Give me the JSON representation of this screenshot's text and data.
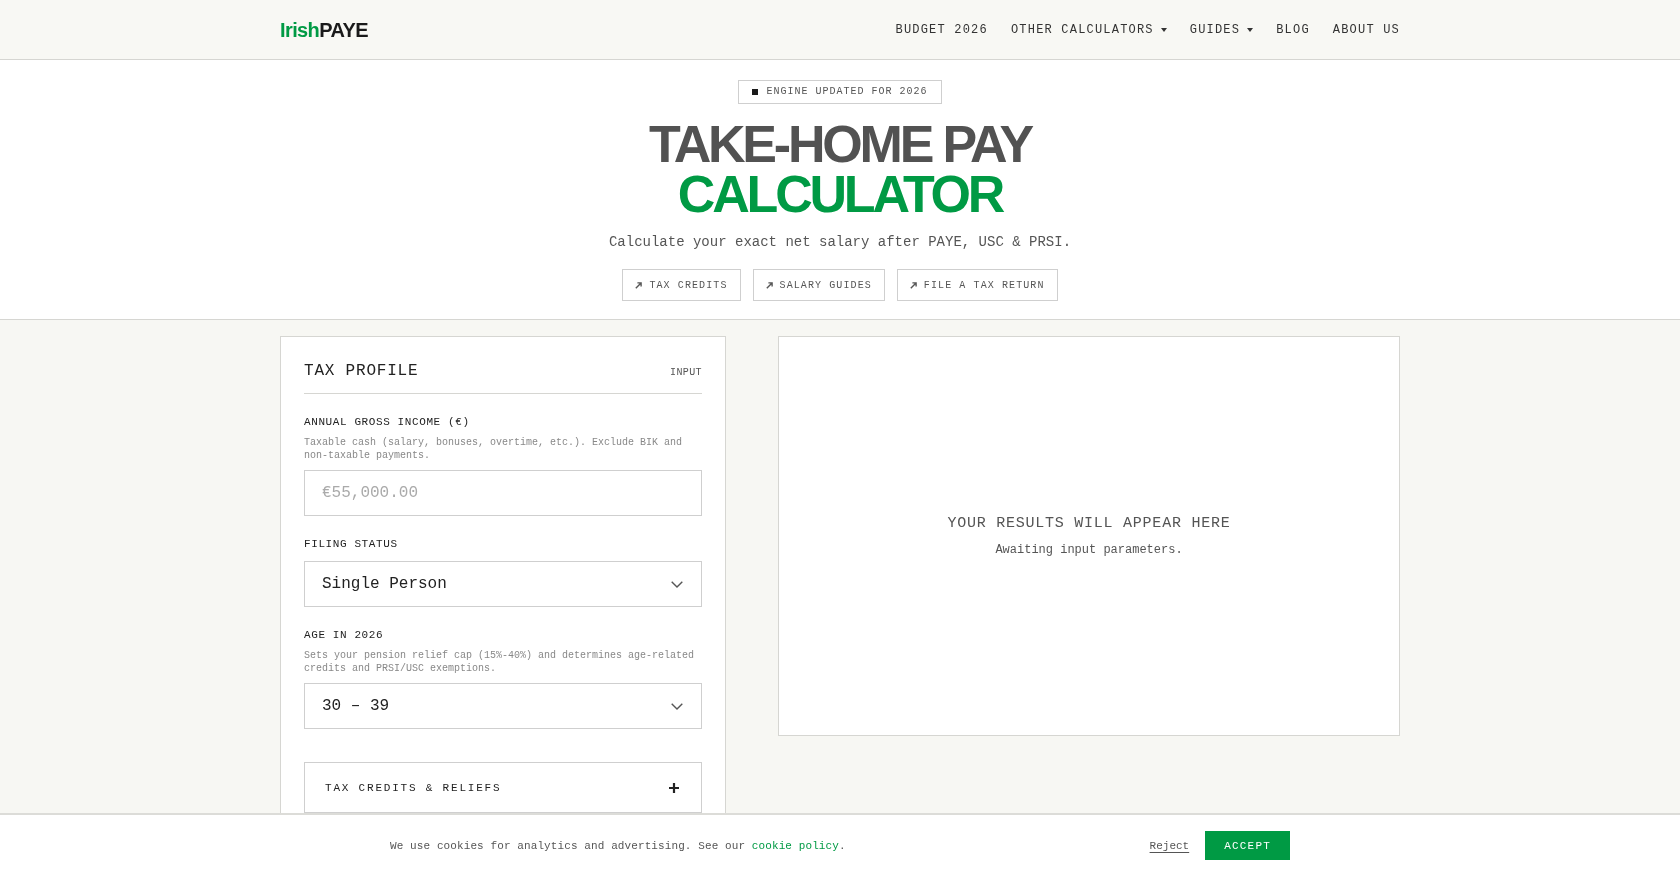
{
  "header": {
    "logo": {
      "part_1": "Irish",
      "part_2": "PAYE"
    },
    "nav": [
      {
        "label": "BUDGET 2026",
        "dropdown": false
      },
      {
        "label": "OTHER CALCULATORS",
        "dropdown": true
      },
      {
        "label": "GUIDES",
        "dropdown": true
      },
      {
        "label": "BLOG",
        "dropdown": false
      },
      {
        "label": "ABOUT US",
        "dropdown": false
      }
    ]
  },
  "hero": {
    "badge": "ENGINE UPDATED FOR 2026",
    "title": {
      "line_1": "TAKE-HOME PAY",
      "line_2": "CALCULATOR"
    },
    "subtitle": "Calculate your exact net salary after PAYE, USC & PRSI.",
    "links": [
      "TAX CREDITS",
      "SALARY GUIDES",
      "FILE A TAX RETURN"
    ]
  },
  "tax_profile": {
    "title": "TAX PROFILE",
    "tag": "INPUT",
    "fields": [
      {
        "kind": "input",
        "label": "ANNUAL GROSS INCOME (€)",
        "help": "Taxable cash (salary, bonuses, overtime, etc.). Exclude BIK and non-taxable payments.",
        "placeholder": "€55,000.00"
      },
      {
        "kind": "select",
        "label": "FILING STATUS",
        "value": "Single Person"
      },
      {
        "kind": "select",
        "label": "AGE IN 2026",
        "help": "Sets your pension relief cap (15%-40%) and determines age-related credits and PRSI/USC exemptions.",
        "value": "30 – 39"
      }
    ],
    "accordion": {
      "label": "TAX CREDITS & RELIEFS",
      "expanded": false
    }
  },
  "results": {
    "title": "YOUR RESULTS WILL APPEAR HERE",
    "subtitle": "Awaiting input parameters."
  },
  "cookie_banner": {
    "text_before": "We use cookies for analytics and advertising. See our ",
    "link": "cookie policy",
    "text_after": ".",
    "reject": "Reject",
    "accept": "ACCEPT"
  }
}
